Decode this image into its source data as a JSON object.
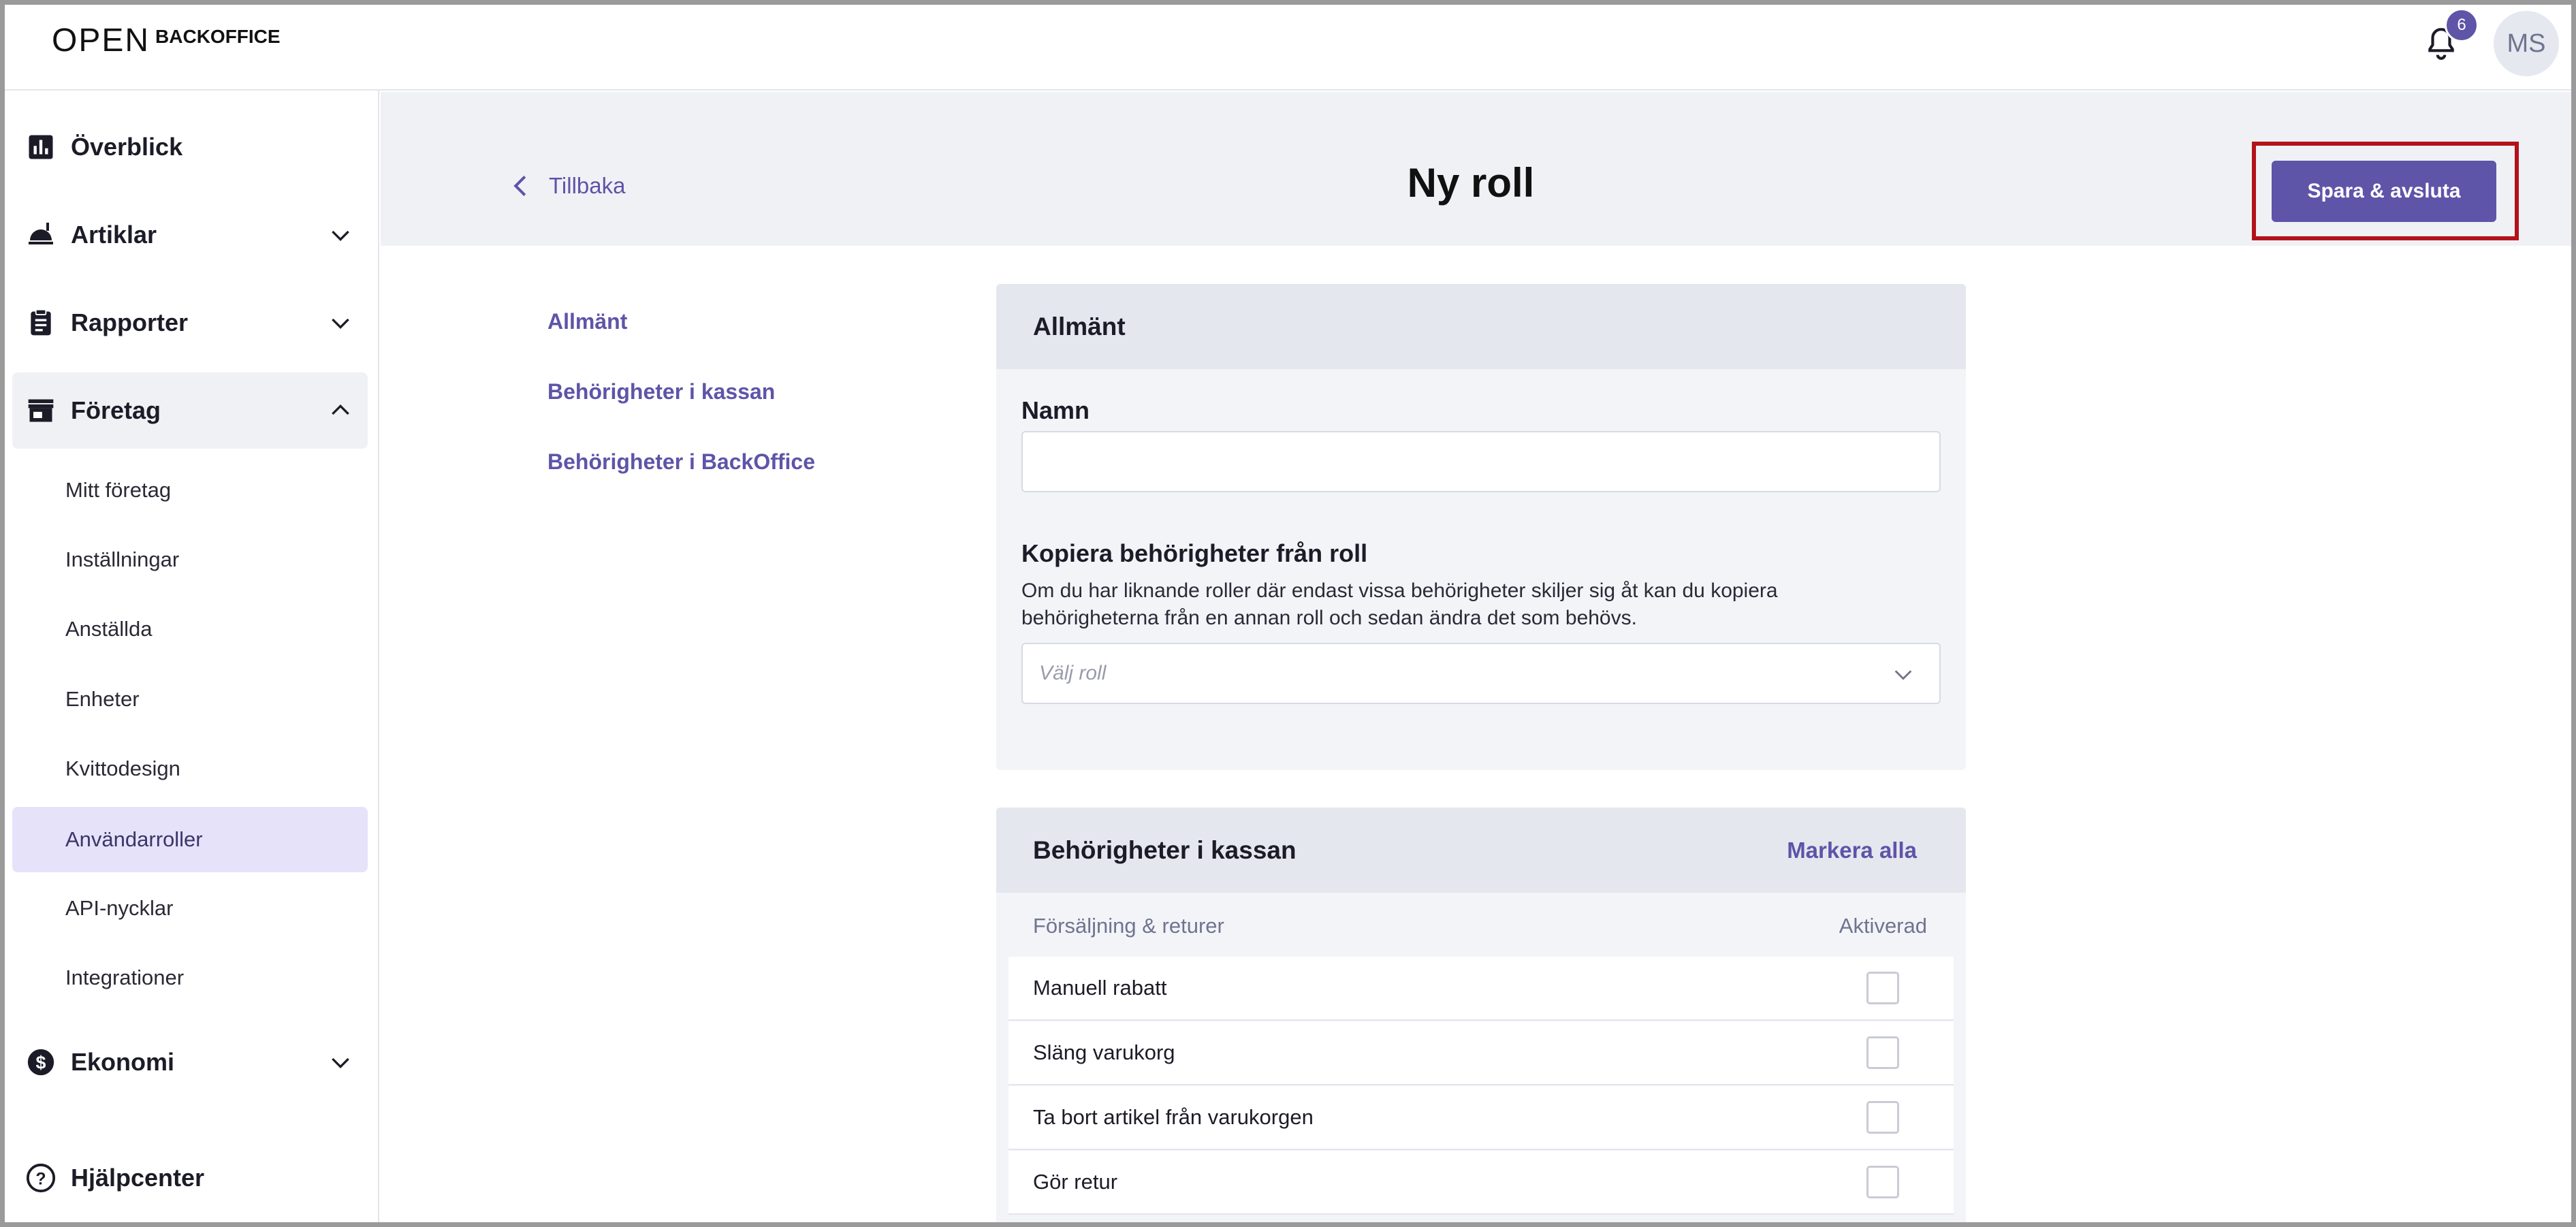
{
  "topbar": {
    "logo_open": "OPEN",
    "logo_back": "BACKOFFICE",
    "notification_count": "6",
    "avatar_initials": "MS"
  },
  "sidebar": {
    "main_items": [
      {
        "label": "Överblick",
        "icon": "bar-chart-icon",
        "expandable": false
      },
      {
        "label": "Artiklar",
        "icon": "food-tray-icon",
        "expandable": true,
        "expanded": false
      },
      {
        "label": "Rapporter",
        "icon": "clipboard-icon",
        "expandable": true,
        "expanded": false
      },
      {
        "label": "Företag",
        "icon": "store-icon",
        "expandable": true,
        "expanded": true
      },
      {
        "label": "Ekonomi",
        "icon": "dollar-icon",
        "expandable": true,
        "expanded": false
      },
      {
        "label": "Hjälpcenter",
        "icon": "help-icon",
        "expandable": false
      }
    ],
    "sub_items": [
      {
        "label": "Mitt företag"
      },
      {
        "label": "Inställningar"
      },
      {
        "label": "Anställda"
      },
      {
        "label": "Enheter"
      },
      {
        "label": "Kvittodesign"
      },
      {
        "label": "Användarroller",
        "active": true
      },
      {
        "label": "API-nycklar"
      },
      {
        "label": "Integrationer"
      }
    ]
  },
  "header": {
    "back_label": "Tillbaka",
    "title": "Ny roll",
    "save_label": "Spara & avsluta"
  },
  "section_nav": [
    "Allmänt",
    "Behörigheter i kassan",
    "Behörigheter i BackOffice"
  ],
  "general": {
    "title": "Allmänt",
    "name_label": "Namn",
    "name_value": "",
    "copy_label": "Kopiera behörigheter från roll",
    "copy_help": "Om du har liknande roller där endast vissa behörigheter skiljer sig åt kan du kopiera behörigheterna från en annan roll och sedan ändra det som behövs.",
    "copy_placeholder": "Välj roll"
  },
  "pos_permissions": {
    "title": "Behörigheter i kassan",
    "mark_all": "Markera alla",
    "group_label": "Försäljning & returer",
    "enabled_label": "Aktiverad",
    "rows": [
      {
        "label": "Manuell rabatt",
        "checked": false
      },
      {
        "label": "Släng varukorg",
        "checked": false
      },
      {
        "label": "Ta bort artikel från varukorgen",
        "checked": false
      },
      {
        "label": "Gör retur",
        "checked": false
      }
    ]
  },
  "colors": {
    "accent": "#5e54a8",
    "highlight": "#b3121b",
    "active_nav": "#e5e2fa"
  }
}
